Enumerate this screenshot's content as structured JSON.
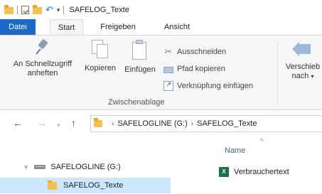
{
  "window": {
    "title": "SAFELOG_Texte"
  },
  "ribbon_tabs": [
    "Datei",
    "Start",
    "Freigeben",
    "Ansicht"
  ],
  "ribbon": {
    "pin_label_1": "An Schnellzugriff",
    "pin_label_2": "anheften",
    "copy_label": "Kopieren",
    "paste_label": "Einfügen",
    "cut_label": "Ausschneiden",
    "copy_path_label": "Pfad kopieren",
    "paste_shortcut_label": "Verknüpfung einfügen",
    "clipboard_group": "Zwischenablage",
    "move_label_1": "Verschieb",
    "move_label_2": "nach"
  },
  "address": {
    "crumbs": [
      "SAFELOGLINE (G:)",
      "SAFELOG_Texte"
    ]
  },
  "content": {
    "column_header": "Name",
    "files": [
      {
        "name": "Verbrauchertext",
        "type": "excel"
      }
    ]
  },
  "nav_tree": {
    "drive": "SAFELOGLINE (G:)",
    "selected_folder": "SAFELOG_Texte"
  },
  "colors": {
    "accent": "#1b6ac9",
    "selection": "#cce8ff",
    "folder": "#f2c14e"
  }
}
